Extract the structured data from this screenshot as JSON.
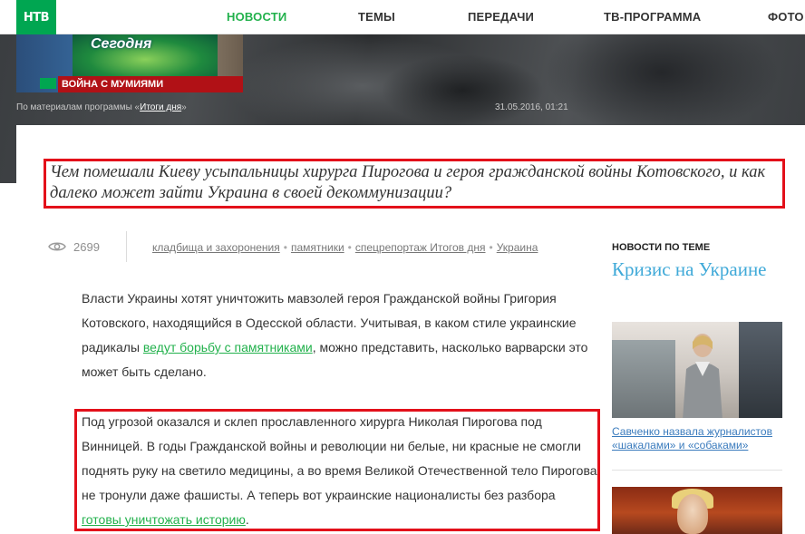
{
  "nav": {
    "items": [
      {
        "label": "НОВОСТИ",
        "active": true
      },
      {
        "label": "ТЕМЫ"
      },
      {
        "label": "ПЕРЕДАЧИ"
      },
      {
        "label": "ТВ-ПРОГРАММА"
      },
      {
        "label": "ФОТО"
      }
    ]
  },
  "logo": {
    "text": "НТВ"
  },
  "video": {
    "show_title": "Сегодня",
    "bar_text": "ВОЙНА С МУМИЯМИ"
  },
  "hero": {
    "source_prefix": "По материалам программы «",
    "source_link": "Итоги дня",
    "source_suffix": "»",
    "date": "31.05.2016, 01:21"
  },
  "article": {
    "lead": "Чем помешали Киеву усыпальницы хирурга Пирогова и героя гражданской войны Котовского, и как далеко может зайти Украина в своей декоммунизации?",
    "views": "2699",
    "tags": [
      "кладбища и захоронения",
      "памятники",
      "спецрепортаж Итогов дня",
      "Украина"
    ],
    "p1_before": "Власти Украины хотят уничтожить мавзолей героя Гражданской войны Григория Котовского, находящийся в Одесской области. Учитывая, в каком стиле украинские радикалы ",
    "p1_link": "ведут борьбу с памятниками",
    "p1_after": ", можно представить, насколько варварски это может быть сделано.",
    "p2_before": "Под угрозой оказался и склеп прославленного хирурга Николая Пирогова под Винницей. В годы Гражданской войны и революции ни белые, ни красные не смогли поднять руку на светило медицины, а во время Великой Отечественной тело Пирогова не тронули даже фашисты. А теперь вот украинские националисты без разбора ",
    "p2_link": "готовы уничтожать историю",
    "p2_after": "."
  },
  "related": {
    "heading": "НОВОСТИ ПО ТЕМЕ",
    "topic": "Кризис на Украине",
    "items": [
      {
        "caption": "Савченко назвала журналистов «шакалами» и «собаками»"
      }
    ]
  },
  "colors": {
    "accent_green": "#22b14c",
    "highlight_red": "#e3101a",
    "topic_blue": "#3fa9d8"
  }
}
